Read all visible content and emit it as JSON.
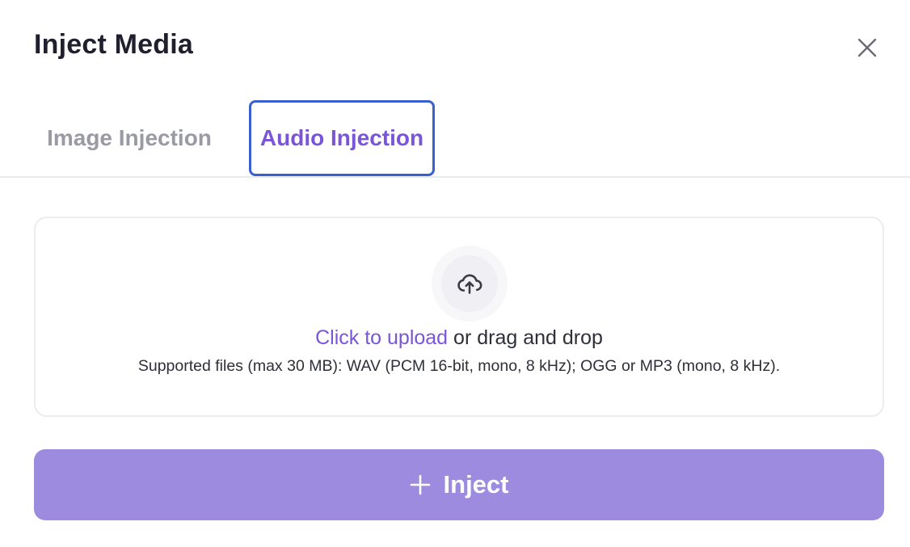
{
  "modal": {
    "title": "Inject Media"
  },
  "tabs": [
    {
      "label": "Image Injection",
      "active": false
    },
    {
      "label": "Audio Injection",
      "active": true
    }
  ],
  "dropzone": {
    "link_text": "Click to upload",
    "rest_text": " or drag and drop",
    "supported_text": "Supported files (max 30 MB): WAV (PCM 16-bit, mono, 8 kHz); OGG or MP3 (mono, 8 kHz)."
  },
  "actions": {
    "inject_label": "Inject"
  },
  "icons": {
    "close": "close-icon",
    "upload": "cloud-upload-icon",
    "inject": "plus-icon"
  },
  "colors": {
    "accent": "#7a55d8",
    "button": "#9d8be0",
    "focus_ring": "#3a5fcf",
    "muted_tab": "#9a9aa5"
  }
}
